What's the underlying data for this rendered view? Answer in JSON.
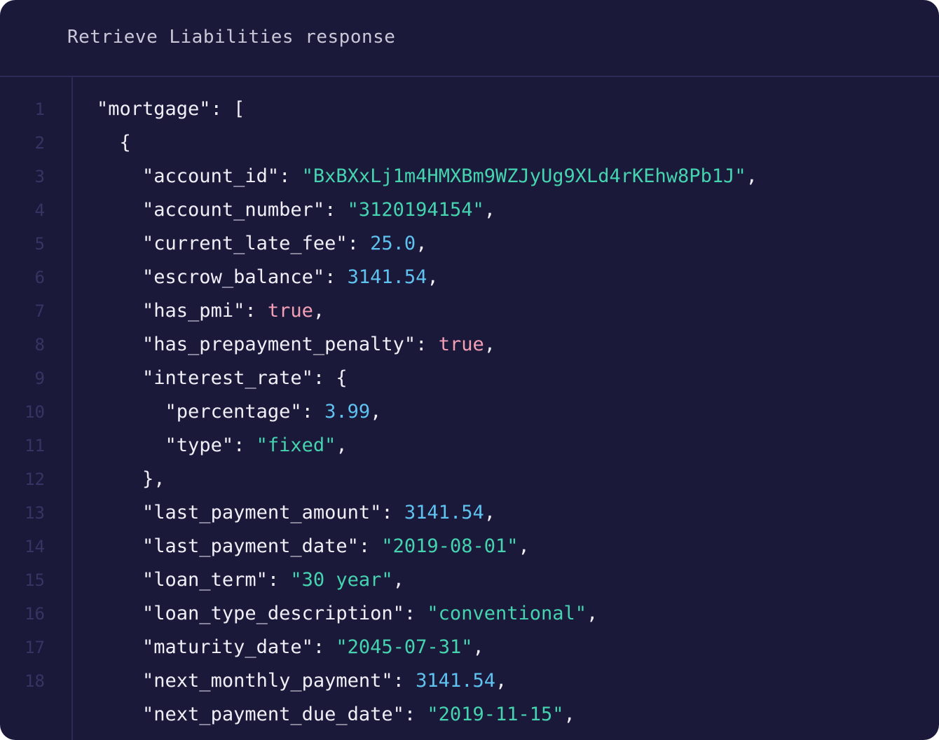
{
  "header": {
    "title": "Retrieve Liabilities response"
  },
  "line_numbers": [
    "1",
    "2",
    "3",
    "4",
    "5",
    "6",
    "7",
    "8",
    "9",
    "10",
    "11",
    "12",
    "13",
    "14",
    "15",
    "16",
    "17",
    "18"
  ],
  "lines": [
    {
      "indent": "",
      "key": "\"mortgage\"",
      "sep": ": ",
      "value": "[",
      "vtype": "punc",
      "tail": ""
    },
    {
      "indent": "  ",
      "key": "",
      "sep": "",
      "value": "{",
      "vtype": "punc",
      "tail": ""
    },
    {
      "indent": "    ",
      "key": "\"account_id\"",
      "sep": ": ",
      "value": "\"BxBXxLj1m4HMXBm9WZJyUg9XLd4rKEhw8Pb1J\"",
      "vtype": "str",
      "tail": ","
    },
    {
      "indent": "    ",
      "key": "\"account_number\"",
      "sep": ": ",
      "value": "\"3120194154\"",
      "vtype": "str",
      "tail": ","
    },
    {
      "indent": "    ",
      "key": "\"current_late_fee\"",
      "sep": ": ",
      "value": "25.0",
      "vtype": "num",
      "tail": ","
    },
    {
      "indent": "    ",
      "key": "\"escrow_balance\"",
      "sep": ": ",
      "value": "3141.54",
      "vtype": "num",
      "tail": ","
    },
    {
      "indent": "    ",
      "key": "\"has_pmi\"",
      "sep": ": ",
      "value": "true",
      "vtype": "bool",
      "tail": ","
    },
    {
      "indent": "    ",
      "key": "\"has_prepayment_penalty\"",
      "sep": ": ",
      "value": "true",
      "vtype": "bool",
      "tail": ","
    },
    {
      "indent": "    ",
      "key": "\"interest_rate\"",
      "sep": ": ",
      "value": "{",
      "vtype": "punc",
      "tail": ""
    },
    {
      "indent": "      ",
      "key": "\"percentage\"",
      "sep": ": ",
      "value": "3.99",
      "vtype": "num",
      "tail": ","
    },
    {
      "indent": "      ",
      "key": "\"type\"",
      "sep": ": ",
      "value": "\"fixed\"",
      "vtype": "str",
      "tail": ","
    },
    {
      "indent": "    ",
      "key": "",
      "sep": "",
      "value": "},",
      "vtype": "punc",
      "tail": ""
    },
    {
      "indent": "    ",
      "key": "\"last_payment_amount\"",
      "sep": ": ",
      "value": "3141.54",
      "vtype": "num",
      "tail": ","
    },
    {
      "indent": "    ",
      "key": "\"last_payment_date\"",
      "sep": ": ",
      "value": "\"2019-08-01\"",
      "vtype": "str",
      "tail": ","
    },
    {
      "indent": "    ",
      "key": "\"loan_term\"",
      "sep": ": ",
      "value": "\"30 year\"",
      "vtype": "str",
      "tail": ","
    },
    {
      "indent": "    ",
      "key": "\"loan_type_description\"",
      "sep": ": ",
      "value": "\"conventional\"",
      "vtype": "str",
      "tail": ","
    },
    {
      "indent": "    ",
      "key": "\"maturity_date\"",
      "sep": ": ",
      "value": "\"2045-07-31\"",
      "vtype": "str",
      "tail": ","
    },
    {
      "indent": "    ",
      "key": "\"next_monthly_payment\"",
      "sep": ": ",
      "value": "3141.54",
      "vtype": "num",
      "tail": ","
    },
    {
      "indent": "    ",
      "key": "\"next_payment_due_date\"",
      "sep": ": ",
      "value": "\"2019-11-15\"",
      "vtype": "str",
      "tail": ","
    }
  ],
  "colors": {
    "background": "#1b1939",
    "string": "#45d3b0",
    "number": "#5fc2f0",
    "boolean": "#f3a0b6",
    "text": "#f0eff7"
  }
}
